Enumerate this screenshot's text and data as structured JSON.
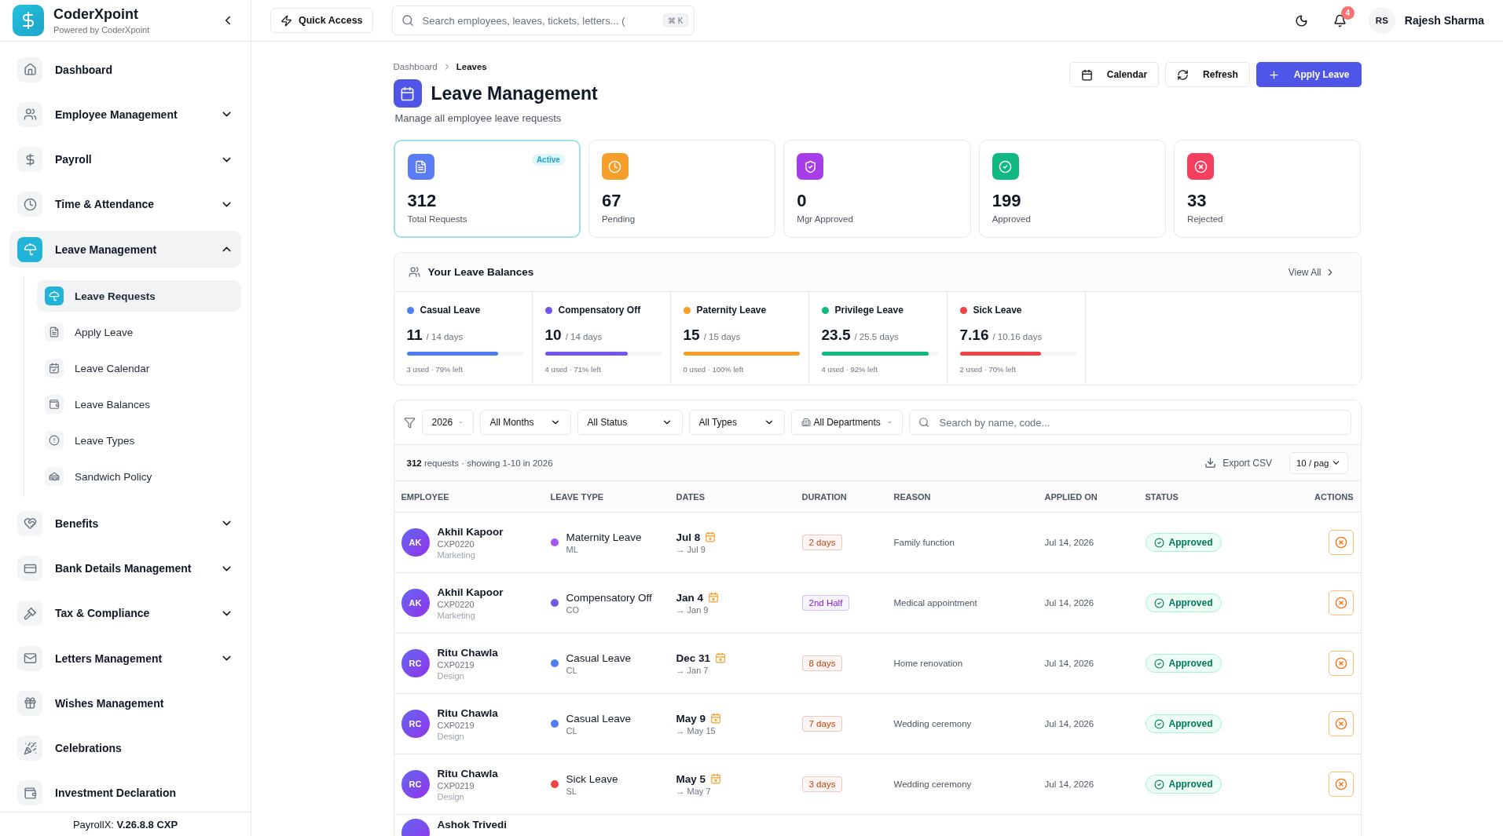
{
  "brand": {
    "name": "CoderXpoint",
    "subtitle": "Powered by CoderXpoint"
  },
  "sidebar": {
    "items": [
      {
        "label": "Dashboard",
        "kind": "link",
        "selected": false
      },
      {
        "label": "Employee Management",
        "kind": "group",
        "expanded": false,
        "selected": false
      },
      {
        "label": "Payroll",
        "kind": "group",
        "expanded": false,
        "selected": false
      },
      {
        "label": "Time & Attendance",
        "kind": "group",
        "expanded": false,
        "selected": false
      },
      {
        "label": "Leave Management",
        "kind": "group",
        "expanded": true,
        "selected": true,
        "children": [
          {
            "label": "Leave Requests",
            "selected": true
          },
          {
            "label": "Apply Leave",
            "selected": false
          },
          {
            "label": "Leave Calendar",
            "selected": false
          },
          {
            "label": "Leave Balances",
            "selected": false
          },
          {
            "label": "Leave Types",
            "selected": false
          },
          {
            "label": "Sandwich Policy",
            "selected": false
          }
        ]
      },
      {
        "label": "Benefits",
        "kind": "group",
        "expanded": false,
        "selected": false
      },
      {
        "label": "Bank Details Management",
        "kind": "group",
        "expanded": false,
        "selected": false
      },
      {
        "label": "Tax & Compliance",
        "kind": "group",
        "expanded": false,
        "selected": false
      },
      {
        "label": "Letters Management",
        "kind": "group",
        "expanded": false,
        "selected": false
      },
      {
        "label": "Wishes Management",
        "kind": "link",
        "selected": false
      },
      {
        "label": "Celebrations",
        "kind": "link",
        "selected": false
      },
      {
        "label": "Investment Declaration",
        "kind": "link",
        "selected": false
      }
    ],
    "footer": "PayrollX: **V.26.8.8 CXP**"
  },
  "header": {
    "quick_access": "Quick Access",
    "search": {
      "placeholder": "Search employees, leaves, tickets, letters... (",
      "shortcut": "⌘ K"
    },
    "notifications": "4",
    "user": {
      "initials": "RS",
      "name": "Rajesh Sharma"
    }
  },
  "page": {
    "breadcrumb": [
      {
        "label": "Dashboard",
        "current": false
      },
      {
        "label": "Leaves",
        "current": true
      }
    ],
    "title": "Leave Management",
    "subtitle": "Manage all employee leave requests",
    "actions": [
      {
        "label": "Calendar",
        "kind": "calendar"
      },
      {
        "label": "Refresh",
        "kind": "refresh"
      },
      {
        "label": "Apply Leave",
        "kind": "primary"
      }
    ]
  },
  "stats": [
    {
      "value": "312",
      "label": "Total Requests",
      "color": "#5b7cf5",
      "selected": true,
      "badge": "Active"
    },
    {
      "value": "67",
      "label": "Pending",
      "color": "#f59e2a",
      "selected": false
    },
    {
      "value": "0",
      "label": "Mgr Approved",
      "color": "#a63de8",
      "selected": false
    },
    {
      "value": "199",
      "label": "Approved",
      "color": "#10b981",
      "selected": false
    },
    {
      "value": "33",
      "label": "Rejected",
      "color": "#f43f5e",
      "selected": false
    }
  ],
  "balances": {
    "title": "Your Leave Balances",
    "view_all": "View All",
    "items": [
      {
        "name": "Casual Leave",
        "color": "#4f7ef2",
        "value": "11",
        "total": "/ 14 days",
        "level": 0.79,
        "note": "3 used · 79% left"
      },
      {
        "name": "Compensatory Off",
        "color": "#7456e8",
        "value": "10",
        "total": "/ 14 days",
        "level": 0.71,
        "note": "4 used · 71% left"
      },
      {
        "name": "Paternity Leave",
        "color": "#f59e2a",
        "value": "15",
        "total": "/ 15 days",
        "level": 1,
        "note": "0 used · 100% left"
      },
      {
        "name": "Privilege Leave",
        "color": "#10b981",
        "value": "23.5",
        "total": "/ 25.5 days",
        "level": 0.92,
        "note": "4 used · 92% left"
      },
      {
        "name": "Sick Leave",
        "color": "#ef4444",
        "value": "7.16",
        "total": "/ 10.16 days",
        "level": 0.7,
        "note": "2 used · 70% left"
      }
    ]
  },
  "filters": {
    "selects": [
      {
        "label": "2026",
        "kind": "plain"
      },
      {
        "label": "All Months",
        "kind": "plain"
      },
      {
        "label": "All Status",
        "kind": "plain"
      },
      {
        "label": "All Types",
        "kind": "plain"
      },
      {
        "label": "All Departments",
        "kind": "building"
      }
    ],
    "search_placeholder": "Search by name, code..."
  },
  "summary": {
    "text": "**312** requests · showing 1-10 in 2026",
    "export": "Export CSV",
    "page_size": "10 / pag"
  },
  "table": {
    "columns": [
      "EMPLOYEE",
      "LEAVE TYPE",
      "DATES",
      "DURATION",
      "REASON",
      "APPLIED ON",
      "STATUS",
      "ACTIONS"
    ],
    "rows": [
      {
        "initials": "AK",
        "name": "Akhil Kapoor",
        "code": "CXP0220",
        "dept": "Marketing",
        "leave": "Maternity Leave",
        "leave_code": "ML",
        "color": "#a855f7",
        "from": "Jul 8",
        "to": "→ Jul 9",
        "duration": {
          "text": "2 days",
          "color": "#c2410c"
        },
        "reason": "Family function",
        "applied": "Jul 14, 2026",
        "status": "Approved"
      },
      {
        "initials": "AK",
        "name": "Akhil Kapoor",
        "code": "CXP0220",
        "dept": "Marketing",
        "leave": "Compensatory Off",
        "leave_code": "CO",
        "color": "#7456e8",
        "from": "Jan 4",
        "to": "→ Jan 9",
        "duration": {
          "text": "2nd Half",
          "color": "#7e22ce"
        },
        "reason": "Medical appointment",
        "applied": "Jul 14, 2026",
        "status": "Approved"
      },
      {
        "initials": "RC",
        "name": "Ritu Chawla",
        "code": "CXP0219",
        "dept": "Design",
        "leave": "Casual Leave",
        "leave_code": "CL",
        "color": "#4f7ef2",
        "from": "Dec 31",
        "to": "→ Jan 7",
        "duration": {
          "text": "8 days",
          "color": "#c2410c"
        },
        "reason": "Home renovation",
        "applied": "Jul 14, 2026",
        "status": "Approved"
      },
      {
        "initials": "RC",
        "name": "Ritu Chawla",
        "code": "CXP0219",
        "dept": "Design",
        "leave": "Casual Leave",
        "leave_code": "CL",
        "color": "#4f7ef2",
        "from": "May 9",
        "to": "→ May 15",
        "duration": {
          "text": "7 days",
          "color": "#c2410c"
        },
        "reason": "Wedding ceremony",
        "applied": "Jul 14, 2026",
        "status": "Approved"
      },
      {
        "initials": "RC",
        "name": "Ritu Chawla",
        "code": "CXP0219",
        "dept": "Design",
        "leave": "Sick Leave",
        "leave_code": "SL",
        "color": "#ef4444",
        "from": "May 5",
        "to": "→ May 7",
        "duration": {
          "text": "3 days",
          "color": "#c2410c"
        },
        "reason": "Wedding ceremony",
        "applied": "Jul 14, 2026",
        "status": "Approved"
      }
    ],
    "partial_row": {
      "name": "Ashok Trivedi"
    }
  }
}
